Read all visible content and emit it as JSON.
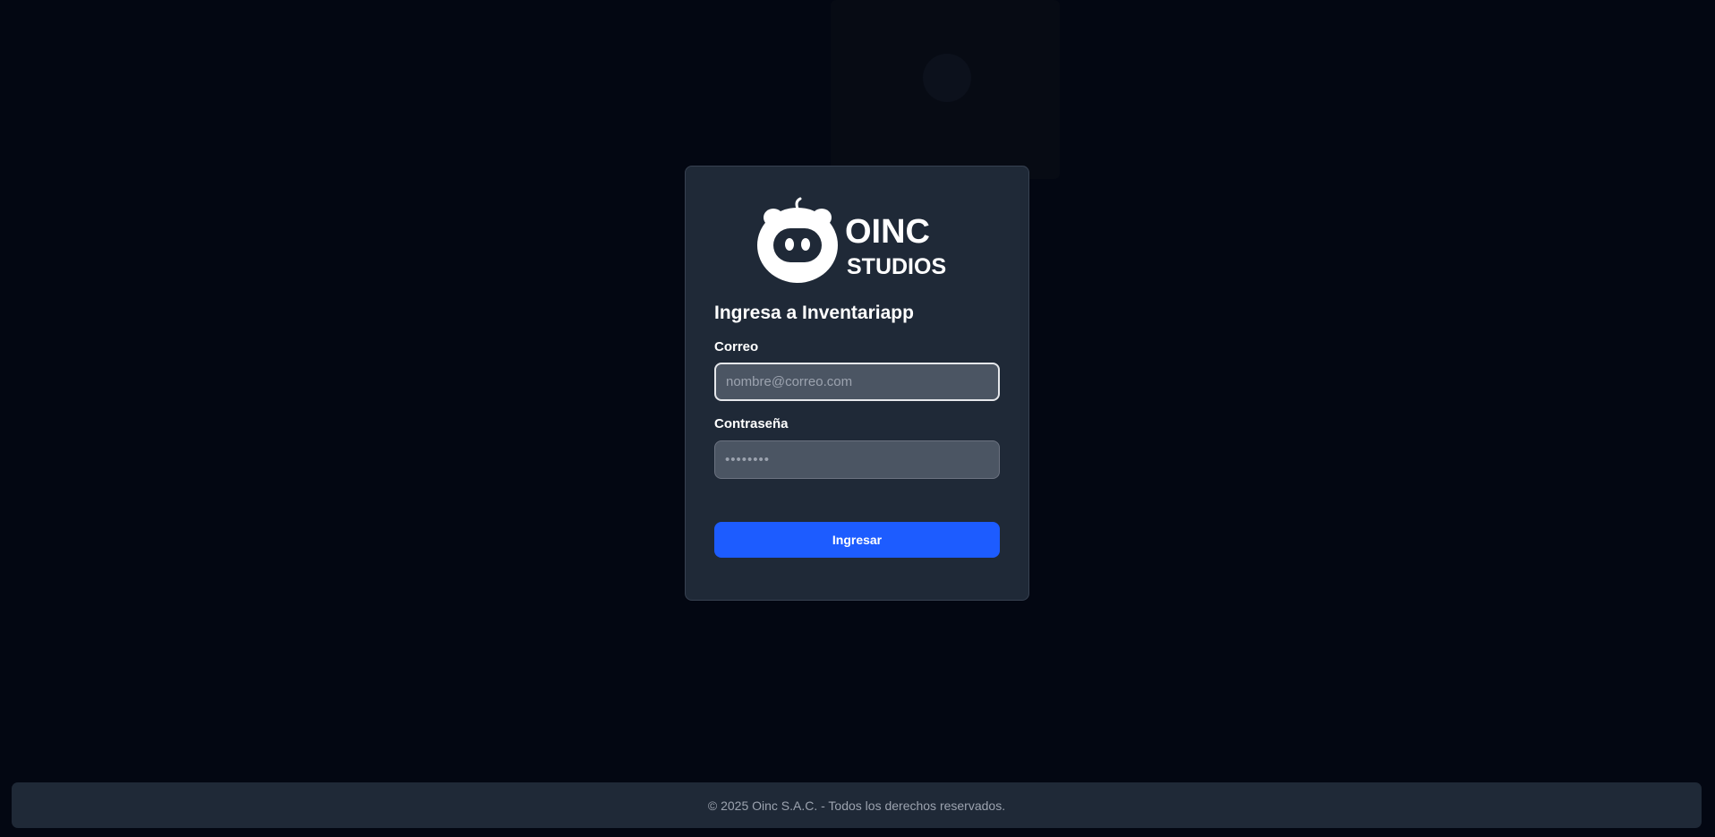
{
  "logo": {
    "icon": "pig-face-icon",
    "line1": "OINC",
    "line2": "STUDIOS"
  },
  "login": {
    "title": "Ingresa a Inventariapp",
    "email_label": "Correo",
    "email_placeholder": "nombre@correo.com",
    "email_value": "",
    "password_label": "Contraseña",
    "password_placeholder": "••••••••",
    "password_value": "",
    "submit_label": "Ingresar"
  },
  "footer": {
    "text": "© 2025 Oinc S.A.C. - Todos los derechos reservados."
  },
  "colors": {
    "background": "#030712",
    "card": "#1f2937",
    "input": "#4b5563",
    "accent": "#1d5cff",
    "text": "#ffffff",
    "muted": "#9ca3af"
  }
}
